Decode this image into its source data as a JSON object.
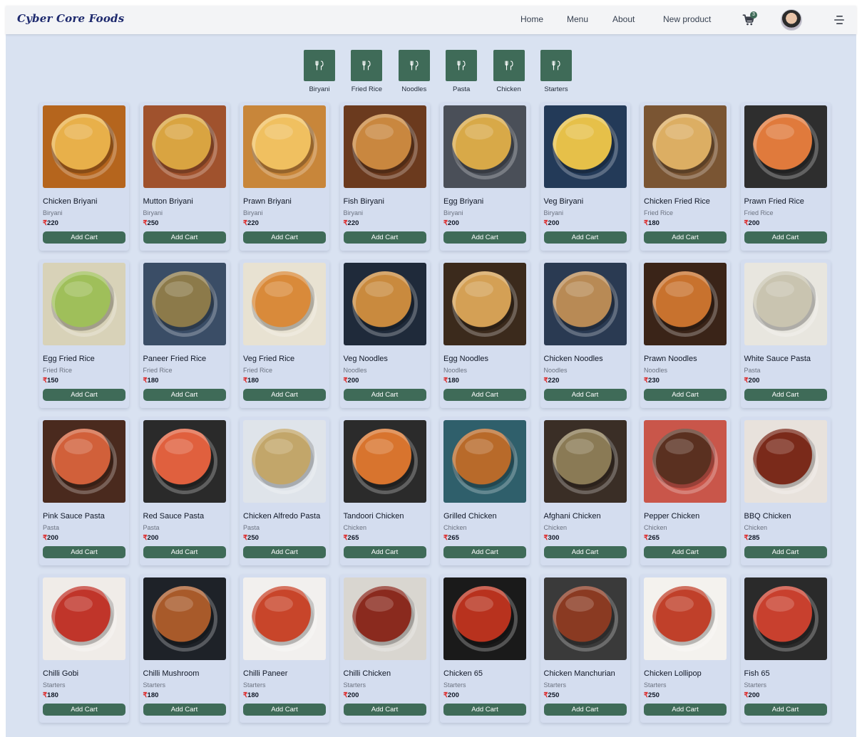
{
  "brand": {
    "name": "Cyber Core Foods",
    "accent": "#3f6b58",
    "price_color": "#dc2626"
  },
  "nav": {
    "links": [
      "Home",
      "Menu",
      "About",
      "New product"
    ],
    "cart_count": "3"
  },
  "categories": [
    {
      "label": "Biryani",
      "icon": "fork-knife-icon"
    },
    {
      "label": "Fried Rice",
      "icon": "fork-knife-icon"
    },
    {
      "label": "Noodles",
      "icon": "fork-knife-icon"
    },
    {
      "label": "Pasta",
      "icon": "fork-knife-icon"
    },
    {
      "label": "Chicken",
      "icon": "fork-knife-icon"
    },
    {
      "label": "Starters",
      "icon": "fork-knife-icon"
    }
  ],
  "currency_symbol": "₹",
  "add_cart_label": "Add Cart",
  "products": [
    {
      "name": "Chicken Briyani",
      "category": "Biryani",
      "price": "220",
      "colors": [
        "#b5651d",
        "#e8b04a"
      ]
    },
    {
      "name": "Mutton Briyani",
      "category": "Biryani",
      "price": "250",
      "colors": [
        "#a0522d",
        "#d9a441"
      ]
    },
    {
      "name": "Prawn Briyani",
      "category": "Biryani",
      "price": "220",
      "colors": [
        "#c8863a",
        "#f0c060"
      ]
    },
    {
      "name": "Fish Biryani",
      "category": "Biryani",
      "price": "220",
      "colors": [
        "#6b3a1e",
        "#c9873f"
      ]
    },
    {
      "name": "Egg Briyani",
      "category": "Biryani",
      "price": "200",
      "colors": [
        "#4a4f58",
        "#d8a948"
      ]
    },
    {
      "name": "Veg Biryani",
      "category": "Biryani",
      "price": "200",
      "colors": [
        "#233a58",
        "#e6c049"
      ]
    },
    {
      "name": "Chicken Fried Rice",
      "category": "Fried Rice",
      "price": "180",
      "colors": [
        "#7a5533",
        "#dcae63"
      ]
    },
    {
      "name": "Prawn Fried Rice",
      "category": "Fried Rice",
      "price": "200",
      "colors": [
        "#2e2e2e",
        "#e07a3c"
      ]
    },
    {
      "name": "Egg Fried Rice",
      "category": "Fried Rice",
      "price": "150",
      "colors": [
        "#d8d2b8",
        "#9fbf5a"
      ]
    },
    {
      "name": "Paneer Fried Rice",
      "category": "Fried Rice",
      "price": "180",
      "colors": [
        "#3a4d66",
        "#8c7a4a"
      ]
    },
    {
      "name": "Veg Fried Rice",
      "category": "Fried Rice",
      "price": "180",
      "colors": [
        "#e8e2d2",
        "#d98a3a"
      ]
    },
    {
      "name": "Veg Noodles",
      "category": "Noodles",
      "price": "200",
      "colors": [
        "#1f2a3a",
        "#c98a3e"
      ]
    },
    {
      "name": "Egg Noodles",
      "category": "Noodles",
      "price": "180",
      "colors": [
        "#3b2a1c",
        "#d4a055"
      ]
    },
    {
      "name": "Chicken Noodles",
      "category": "Noodles",
      "price": "220",
      "colors": [
        "#2a3a52",
        "#b88a55"
      ]
    },
    {
      "name": "Prawn Noodles",
      "category": "Noodles",
      "price": "230",
      "colors": [
        "#3a2418",
        "#c8722e"
      ]
    },
    {
      "name": "White Sauce Pasta",
      "category": "Pasta",
      "price": "200",
      "colors": [
        "#e8e6df",
        "#c9c4b0"
      ]
    },
    {
      "name": "Pink Sauce Pasta",
      "category": "Pasta",
      "price": "200",
      "colors": [
        "#4a2a1e",
        "#d1603a"
      ]
    },
    {
      "name": "Red Sauce Pasta",
      "category": "Pasta",
      "price": "200",
      "colors": [
        "#2a2a2a",
        "#e0603e"
      ]
    },
    {
      "name": "Chicken Alfredo Pasta",
      "category": "Pasta",
      "price": "250",
      "colors": [
        "#dfe4ea",
        "#c2a66a"
      ]
    },
    {
      "name": "Tandoori Chicken",
      "category": "Chicken",
      "price": "265",
      "colors": [
        "#2b2b2b",
        "#d8742e"
      ]
    },
    {
      "name": "Grilled Chicken",
      "category": "Chicken",
      "price": "265",
      "colors": [
        "#2f5f6b",
        "#b86a2a"
      ]
    },
    {
      "name": "Afghani Chicken",
      "category": "Chicken",
      "price": "300",
      "colors": [
        "#3a2e26",
        "#8a7a55"
      ]
    },
    {
      "name": "Pepper Chicken",
      "category": "Chicken",
      "price": "265",
      "colors": [
        "#c9564a",
        "#5a3020"
      ]
    },
    {
      "name": "BBQ Chicken",
      "category": "Chicken",
      "price": "285",
      "colors": [
        "#e8e2dc",
        "#7a2a1a"
      ]
    },
    {
      "name": "Chilli Gobi",
      "category": "Starters",
      "price": "180",
      "colors": [
        "#f0ece8",
        "#c0352a"
      ]
    },
    {
      "name": "Chilli Mushroom",
      "category": "Starters",
      "price": "180",
      "colors": [
        "#1e2228",
        "#a85a2a"
      ]
    },
    {
      "name": "Chilli Paneer",
      "category": "Starters",
      "price": "180",
      "colors": [
        "#f2f0ee",
        "#c8452a"
      ]
    },
    {
      "name": "Chilli Chicken",
      "category": "Starters",
      "price": "200",
      "colors": [
        "#d9d6d0",
        "#8a2a1e"
      ]
    },
    {
      "name": "Chicken 65",
      "category": "Starters",
      "price": "200",
      "colors": [
        "#1a1a1a",
        "#b8321e"
      ]
    },
    {
      "name": "Chicken Manchurian",
      "category": "Starters",
      "price": "250",
      "colors": [
        "#3a3a3a",
        "#8a3a22"
      ]
    },
    {
      "name": "Chicken Lollipop",
      "category": "Starters",
      "price": "250",
      "colors": [
        "#f4f2ee",
        "#c0402a"
      ]
    },
    {
      "name": "Fish 65",
      "category": "Starters",
      "price": "200",
      "colors": [
        "#2a2a2a",
        "#c8402e"
      ]
    }
  ]
}
